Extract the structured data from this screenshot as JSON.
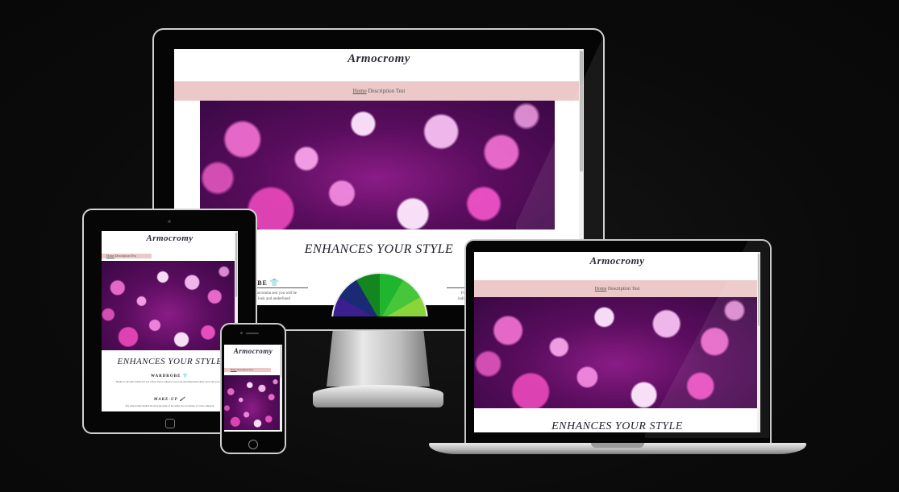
{
  "site": {
    "title": "Armocromy",
    "nav": {
      "home": "Home",
      "description": "Description",
      "test": "Test"
    },
    "headline": "ENHANCES YOUR STYLE",
    "wardrobe_heading": "WARDROBE",
    "wardrobe_heading_partial": "OBE",
    "makeup_heading": "MAKE-UP",
    "wardrobe_text_partial": [
      "armocromia test you will be",
      "our look and underlined"
    ],
    "right_text_partial": [
      "Fi",
      "indi"
    ],
    "wardrobe_text_tablet": "Thanks to the armocromia test you will be able to enhance your look and understand which colors suit you best.",
    "makeup_text_tablet": "The armocromia method involves the study of the subject in accordance of colors, taking in"
  },
  "icons": {
    "shirt": "shirt-icon",
    "brush": "brush-icon"
  },
  "colors": {
    "nav_bg": "#ecc8c8",
    "background": "#0b0b0b"
  }
}
